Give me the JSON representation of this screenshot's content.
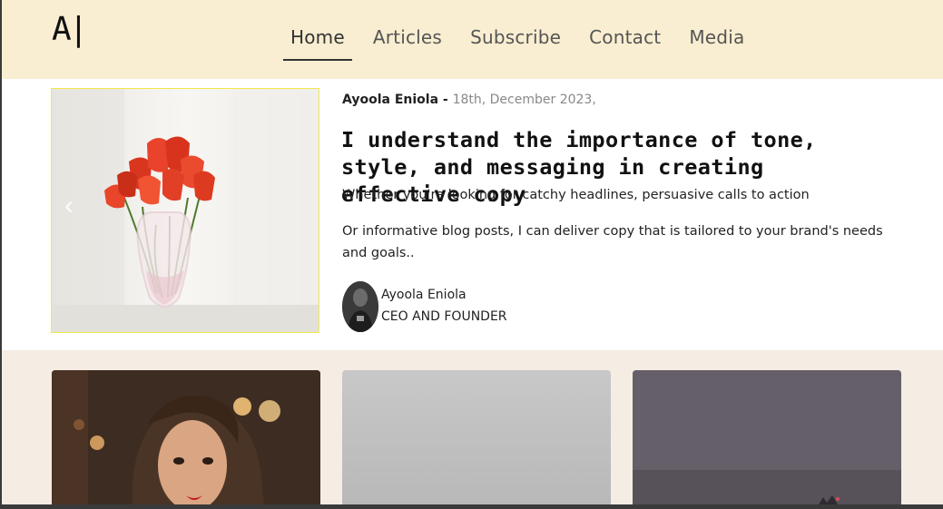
{
  "logo": "A|",
  "nav": {
    "items": [
      {
        "label": "Home",
        "active": true
      },
      {
        "label": "Articles"
      },
      {
        "label": "Subscribe"
      },
      {
        "label": "Contact"
      },
      {
        "label": "Media"
      }
    ]
  },
  "featured": {
    "author": "Ayoola Eniola",
    "separator": " - ",
    "date": "18th, December 2023,",
    "headline": "I understand the importance of tone, style, and messaging in creating effective copy",
    "paragraph1": "Whether you're looking for catchy headlines, persuasive calls to action",
    "paragraph2": "Or informative blog posts, I can deliver copy that is tailored to your brand's needs and goals..",
    "byline": {
      "name": "Ayoola Eniola",
      "role": "CEO AND FOUNDER"
    }
  },
  "colors": {
    "header_bg": "#f9eed1",
    "cards_bg": "#f5ece4",
    "image_border": "#f2e84a"
  }
}
